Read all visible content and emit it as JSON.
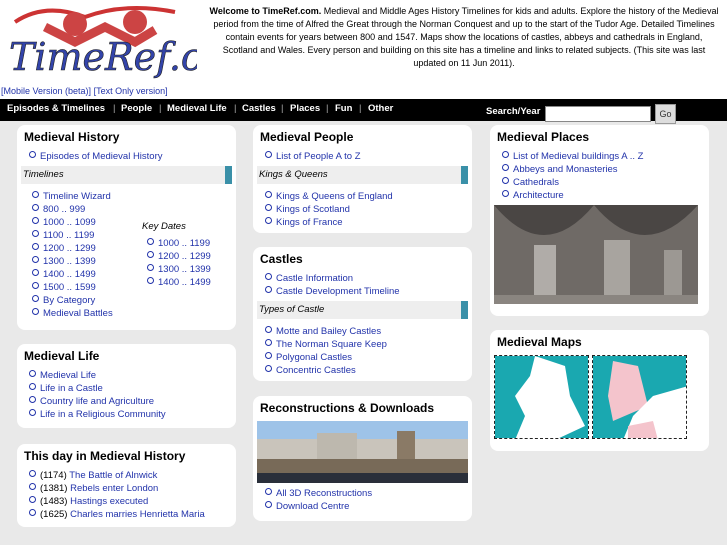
{
  "header": {
    "logo_text": "TimeRef.com",
    "welcome_bold": "Welcome to TimeRef.com.",
    "welcome_text": " Medieval and Middle Ages History Timelines for kids and adults. Explore the history of the Medieval period from the time of Alfred the Great through the Norman Conquest and up to the start of the Tudor Age. Detailed Timelines contain events for years between 800 and 1547. Maps show the locations of castles, abbeys and cathedrals in England, Scotland and Wales. Every person and building on this site has a timeline and links to related subjects. (This site was last updated on 11 Jun 2011).",
    "mobile_link": "[Mobile Version (beta)]",
    "text_link": "[Text Only version]"
  },
  "nav": {
    "items": [
      "Episodes & Timelines",
      "People",
      "Medieval Life",
      "Castles",
      "Places",
      "Fun",
      "Other"
    ],
    "search_label": "Search/Year",
    "search_value": "",
    "go": "Go"
  },
  "history": {
    "title": "Medieval History",
    "episodes": "Episodes of Medieval History",
    "timelines_label": "Timelines",
    "timelines": [
      "Timeline Wizard",
      "800 .. 999",
      "1000 .. 1099",
      "1100 .. 1199",
      "1200 .. 1299",
      "1300 .. 1399",
      "1400 .. 1499",
      "1500 .. 1599",
      "By Category",
      "Medieval Battles"
    ],
    "key_dates_label": "Key Dates",
    "key_dates": [
      "1000 .. 1199",
      "1200 .. 1299",
      "1300 .. 1399",
      "1400 .. 1499"
    ]
  },
  "life": {
    "title": "Medieval Life",
    "items": [
      "Medieval Life",
      "Life in a Castle",
      "Country life and Agriculture",
      "Life in a Religious Community"
    ]
  },
  "today": {
    "title": "This day in Medieval History",
    "items": [
      {
        "year": "(1174)",
        "text": "The Battle of Alnwick"
      },
      {
        "year": "(1381)",
        "text": "Rebels enter London"
      },
      {
        "year": "(1483)",
        "text": "Hastings executed"
      },
      {
        "year": "(1625)",
        "text": "Charles marries Henrietta Maria"
      }
    ]
  },
  "people": {
    "title": "Medieval People",
    "list": "List of People A to Z",
    "sub": "Kings & Queens",
    "items": [
      "Kings & Queens of England",
      "Kings of Scotland",
      "Kings of France"
    ]
  },
  "castles": {
    "title": "Castles",
    "items": [
      "Castle Information",
      "Castle Development Timeline"
    ],
    "sub": "Types of Castle",
    "types": [
      "Motte and Bailey Castles",
      "The Norman Square Keep",
      "Polygonal Castles",
      "Concentric Castles"
    ]
  },
  "recon": {
    "title": "Reconstructions & Downloads",
    "items": [
      "All 3D Reconstructions",
      "Download Centre"
    ]
  },
  "places": {
    "title": "Medieval Places",
    "items": [
      "List of Medieval buildings A .. Z",
      "Abbeys and Monasteries",
      "Cathedrals",
      "Architecture"
    ]
  },
  "maps": {
    "title": "Medieval Maps"
  }
}
